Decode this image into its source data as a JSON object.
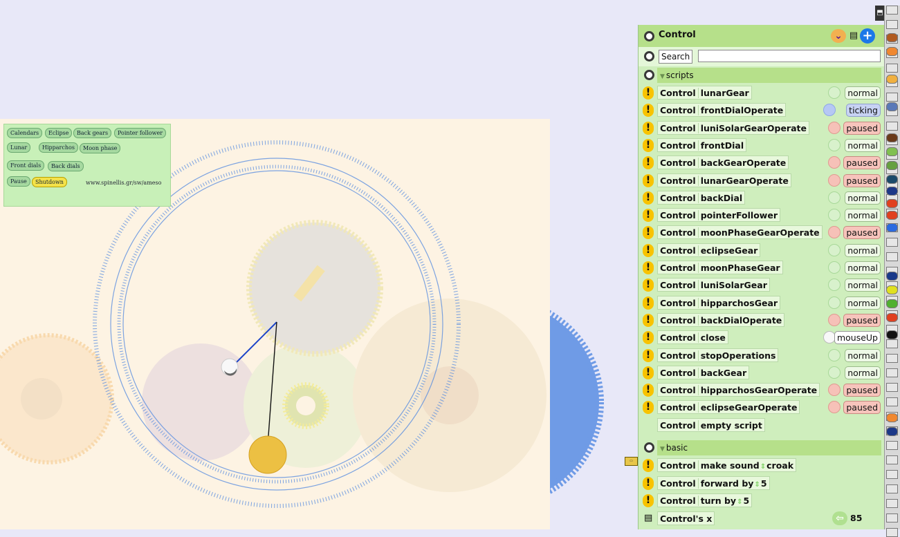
{
  "buttons": {
    "row1": [
      "Calendars",
      "Eclipse",
      "Back gears",
      "Pointer follower"
    ],
    "row2": [
      "Lunar",
      "Hipparchos",
      "Moon phase"
    ],
    "row3": [
      "Front dials",
      "Back dials"
    ],
    "pause": "Pause",
    "shutdown": "Shutdown",
    "site": "www.spinellis.gr/sw/ameso"
  },
  "viewer": {
    "title": "Control",
    "search_label": "Search",
    "search_value": "",
    "scripts_section": "scripts",
    "basic_section": "basic",
    "object_name": "Control",
    "scripts": [
      {
        "name": "lunarGear",
        "status": "normal"
      },
      {
        "name": "frontDialOperate",
        "status": "ticking"
      },
      {
        "name": "luniSolarGearOperate",
        "status": "paused"
      },
      {
        "name": "frontDial",
        "status": "normal"
      },
      {
        "name": "backGearOperate",
        "status": "paused"
      },
      {
        "name": "lunarGearOperate",
        "status": "paused"
      },
      {
        "name": "backDial",
        "status": "normal"
      },
      {
        "name": "pointerFollower",
        "status": "normal"
      },
      {
        "name": "moonPhaseGearOperate",
        "status": "paused"
      },
      {
        "name": "eclipseGear",
        "status": "normal"
      },
      {
        "name": "moonPhaseGear",
        "status": "normal"
      },
      {
        "name": "luniSolarGear",
        "status": "normal"
      },
      {
        "name": "hipparchosGear",
        "status": "normal"
      },
      {
        "name": "backDialOperate",
        "status": "paused"
      },
      {
        "name": "close",
        "status": "mouseUp"
      },
      {
        "name": "stopOperations",
        "status": "normal"
      },
      {
        "name": "backGear",
        "status": "normal"
      },
      {
        "name": "hipparchosGearOperate",
        "status": "paused"
      },
      {
        "name": "eclipseGearOperate",
        "status": "paused"
      },
      {
        "name": "empty script",
        "status": ""
      }
    ],
    "basic": [
      {
        "name": "make sound",
        "arg": "croak"
      },
      {
        "name": "forward by",
        "arg": "5"
      },
      {
        "name": "turn by",
        "arg": "5"
      }
    ],
    "x_label": "Control's x",
    "x_value": "85"
  },
  "colors": {
    "panel_bg": "#cfeebd",
    "header_green": "#b6e08a",
    "paused": "#f7c4bc",
    "ticking": "#c7d2f3",
    "gear_blue": "#6f9be6"
  },
  "palette_colors": [
    "#b05a20",
    "#f08830",
    "#f0b040",
    "#5a78b8",
    "#6a3a1a",
    "#80c050",
    "#66a040",
    "#1a4a6a",
    "#1c3888",
    "#e04020",
    "#e04020",
    "#2a6ae0",
    "#1a3a8a",
    "#e0e020",
    "#50b030",
    "#e04020",
    "#111111",
    "#f08830",
    "#1c3888"
  ]
}
